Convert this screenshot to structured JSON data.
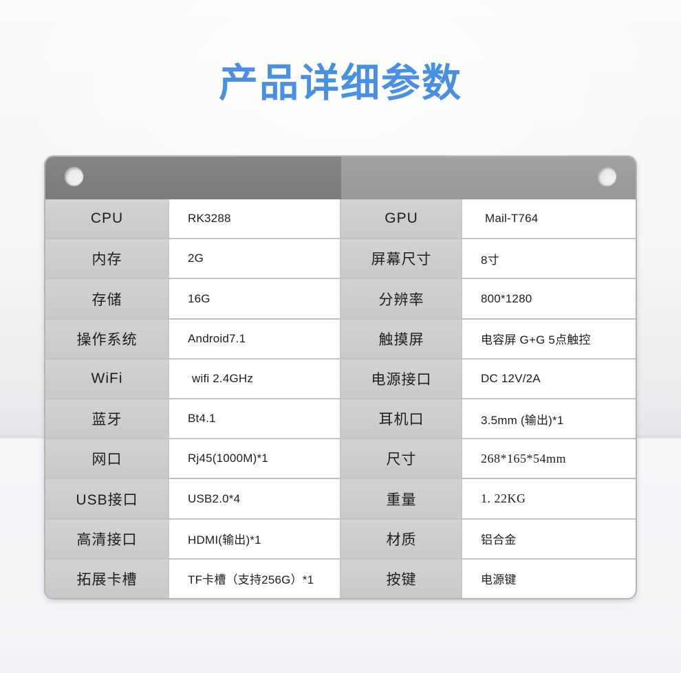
{
  "page": {
    "title": "产品详细参数",
    "title_color": "#4a90e2",
    "background_color": "#f7f7f9"
  },
  "panel": {
    "header": {
      "left_color": "#7f7f7f",
      "right_color": "#9b9b9b",
      "rivet_left": "rivet-hole",
      "rivet_right": "rivet-hole"
    },
    "label_cell_color": "#cdcdcd",
    "value_cell_color": "#ffffff",
    "border_color": "#b4b4b6"
  },
  "spec_table": {
    "left_column": [
      {
        "label": "CPU",
        "value": "RK3288"
      },
      {
        "label": "内存",
        "value": "2G"
      },
      {
        "label": "存储",
        "value": "16G"
      },
      {
        "label": "操作系统",
        "value": "Android7.1"
      },
      {
        "label": "WiFi",
        "value": "wifi 2.4GHz"
      },
      {
        "label": "蓝牙",
        "value": "Bt4.1"
      },
      {
        "label": "网口",
        "value": "Rj45(1000M)*1"
      },
      {
        "label": "USB接口",
        "value": "USB2.0*4"
      },
      {
        "label": "高清接口",
        "value": "HDMI(输出)*1"
      },
      {
        "label": "拓展卡槽",
        "value": "TF卡槽（支持256G）*1"
      }
    ],
    "right_column": [
      {
        "label": "GPU",
        "value": "Mail-T764"
      },
      {
        "label": "屏幕尺寸",
        "value": "8寸"
      },
      {
        "label": "分辨率",
        "value": "800*1280"
      },
      {
        "label": "触摸屏",
        "value": "电容屏 G+G 5点触控"
      },
      {
        "label": "电源接口",
        "value": "DC 12V/2A"
      },
      {
        "label": "耳机口",
        "value": "3.5mm (输出)*1"
      },
      {
        "label": "尺寸",
        "value": "268*165*54mm"
      },
      {
        "label": "重量",
        "value": "1. 22KG"
      },
      {
        "label": "材质",
        "value": "铝合金"
      },
      {
        "label": "按键",
        "value": "电源键"
      }
    ]
  }
}
